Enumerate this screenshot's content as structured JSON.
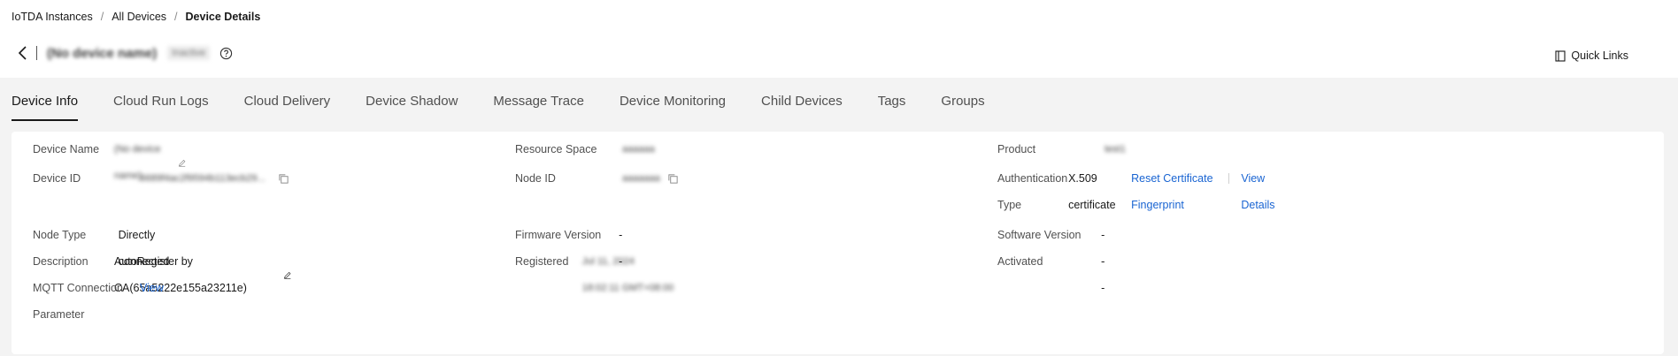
{
  "breadcrumb": {
    "items": [
      "IoTDA Instances",
      "All Devices",
      "Device Details"
    ],
    "separator": "/"
  },
  "header": {
    "title": "(No device name)",
    "status": "Inactive",
    "quick_links": "Quick Links"
  },
  "tabs": [
    {
      "label": "Device Info",
      "active": true
    },
    {
      "label": "Cloud Run Logs"
    },
    {
      "label": "Cloud Delivery"
    },
    {
      "label": "Device Shadow"
    },
    {
      "label": "Message Trace"
    },
    {
      "label": "Device Monitoring"
    },
    {
      "label": "Child Devices"
    },
    {
      "label": "Tags"
    },
    {
      "label": "Groups"
    }
  ],
  "info": {
    "col1": {
      "device_name_label": "Device Name",
      "device_name_value": "(No device name)",
      "device_id_label": "Device ID",
      "device_id_value": "6689f4ac2f9594b113ecb29...",
      "node_type_label": "Node Type",
      "node_type_value": "Directly connected",
      "description_label": "Description",
      "description_value": "AutoRegister by CA(65a5222e155a23211e)",
      "mqtt_label_1": "MQTT Connection",
      "mqtt_label_2": "Parameter",
      "mqtt_value": "View"
    },
    "col2": {
      "resource_space_label": "Resource Space",
      "resource_space_value": "aaaaaa",
      "node_id_label": "Node ID",
      "node_id_value": "aaaaaaa",
      "firmware_label": "Firmware Version",
      "firmware_value": "--",
      "registered_label": "Registered",
      "registered_value": "Jul 11, 2024 18:02:11 GMT+08:00"
    },
    "col3": {
      "product_label": "Product",
      "product_value": "test1",
      "auth_label_1": "Authentication",
      "auth_label_2": "Type",
      "auth_value": "X.509 certificate",
      "reset_link": "Reset Certificate Fingerprint",
      "view_details_link": "View Details",
      "software_label": "Software Version",
      "software_value": "--",
      "activated_label": "Activated",
      "activated_value": "--"
    }
  },
  "colors": {
    "link": "#1964d2",
    "background": "#f3f3f3",
    "text": "#191919"
  }
}
